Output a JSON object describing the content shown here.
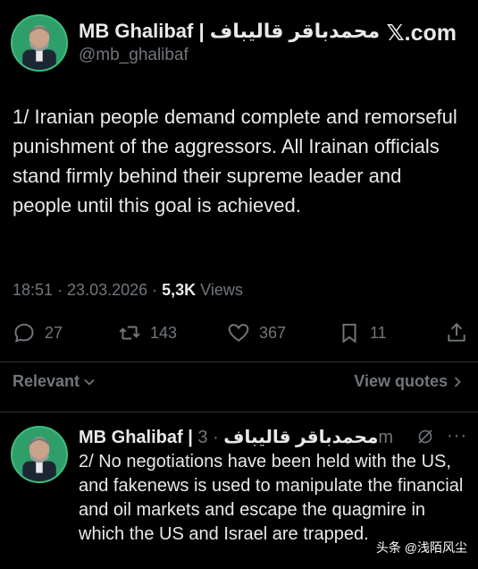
{
  "colors": {
    "background": "#000000",
    "text": "#e7e9ea",
    "muted": "#71767b",
    "divider": "#2f3336",
    "avatar_bg": "#2f9f6a"
  },
  "brand": {
    "logo": "𝕏.com"
  },
  "tweet": {
    "author_name": "MB Ghalibaf | محمدباقر قالیباف",
    "handle": "@mb_ghalibaf",
    "text": "1/ Iranian people demand complete and remorseful punishment of the aggressors. All Irainan officials stand firmly behind their supreme leader and people until this goal is achieved.",
    "time": "18:51 · 23.03.2026 · ",
    "views_count": "5,3K",
    "views_label": " Views",
    "actions": {
      "replies": "27",
      "reposts": "143",
      "likes": "367",
      "bookmarks": "11"
    },
    "icons": {
      "reply": "reply-icon",
      "repost": "repost-icon",
      "like": "heart-icon",
      "bookmark": "bookmark-icon",
      "share": "share-icon"
    }
  },
  "replies_bar": {
    "sort_label": "Relevant",
    "view_quotes_label": "View quotes"
  },
  "reply": {
    "author_name": "MB Ghalibaf | محمدباقر قالیباف",
    "time": " · 3m",
    "text": "2/ No negotiations have been held with the US, and fakenews is used to manipulate the financial and oil markets and escape the quagmire in which the US and Israel are trapped.",
    "more": "···"
  },
  "watermark": "头条 @浅陌风尘"
}
